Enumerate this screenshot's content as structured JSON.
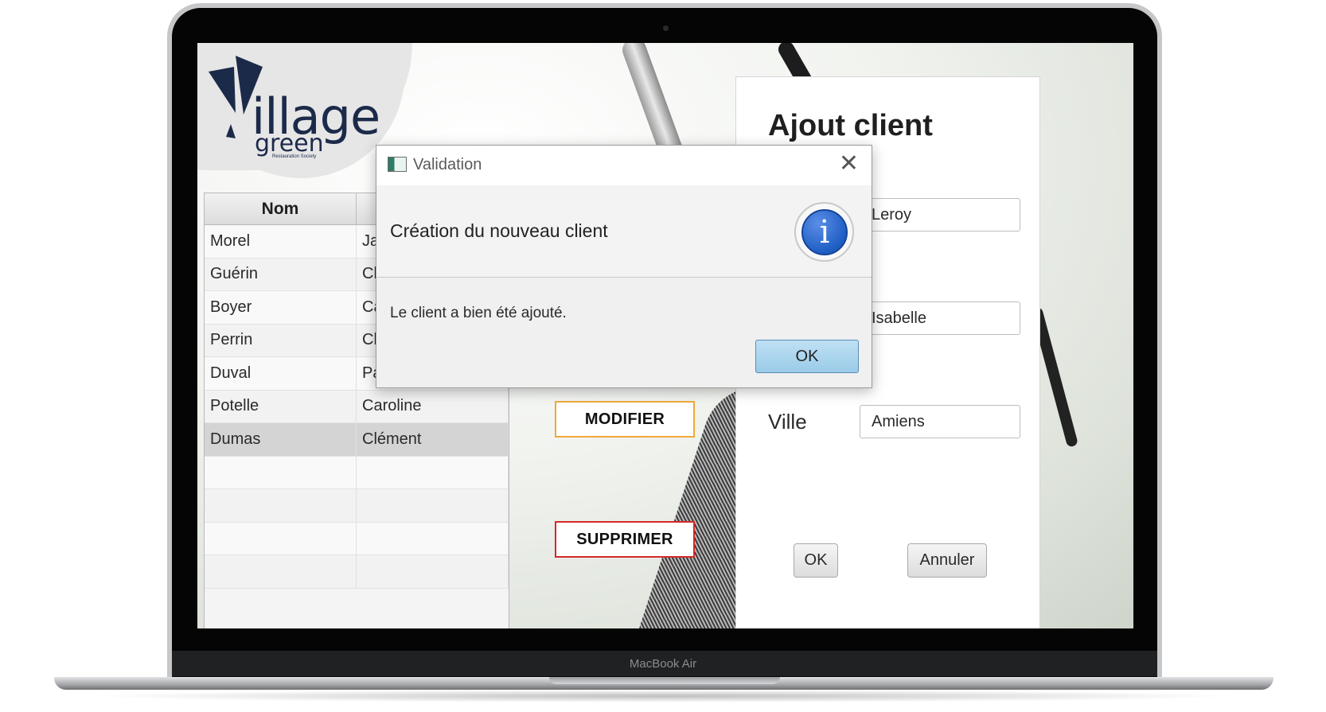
{
  "device": {
    "brand_label": "MacBook Air"
  },
  "logo": {
    "wordmark_main": "illage",
    "wordmark_sub": "green",
    "tagline": "Restauration Society"
  },
  "table": {
    "columns": [
      "Nom",
      ""
    ],
    "rows": [
      {
        "nom": "Morel",
        "prenom": "Ja"
      },
      {
        "nom": "Guérin",
        "prenom": "Ch"
      },
      {
        "nom": "Boyer",
        "prenom": "Ca"
      },
      {
        "nom": "Perrin",
        "prenom": "Cl"
      },
      {
        "nom": "Duval",
        "prenom": "Pa"
      },
      {
        "nom": "Potelle",
        "prenom": "Caroline"
      },
      {
        "nom": "Dumas",
        "prenom": "Clément"
      },
      {
        "nom": "",
        "prenom": ""
      },
      {
        "nom": "",
        "prenom": ""
      },
      {
        "nom": "",
        "prenom": ""
      },
      {
        "nom": "",
        "prenom": ""
      }
    ],
    "selected_index": 6
  },
  "actions": {
    "modify_label": "MODIFIER",
    "delete_label": "SUPPRIMER"
  },
  "form": {
    "title": "Ajout client",
    "field_nom_value": "Leroy",
    "field_prenom_value": "Isabelle",
    "ville_label": "Ville",
    "field_ville_value": "Amiens",
    "ok_label": "OK",
    "cancel_label": "Annuler"
  },
  "dialog": {
    "title": "Validation",
    "close_glyph": "✕",
    "header_text": "Création du nouveau client",
    "info_glyph": "i",
    "body_text": "Le client a bien été ajouté.",
    "ok_label": "OK"
  },
  "colors": {
    "modify_border": "#f0a93a",
    "delete_border": "#d62828",
    "dialog_ok_fill": "#9acbe8",
    "info_icon": "#1f5ec4"
  }
}
